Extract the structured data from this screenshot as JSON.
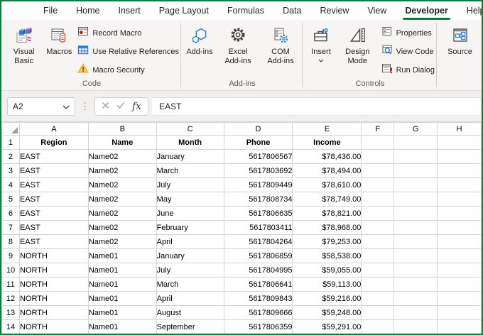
{
  "colors": {
    "accent_green": "#107C41",
    "table_header_fill": "#B4C6E7",
    "icon_blue": "#2E7DD1",
    "icon_red": "#C50F1F",
    "icon_amber": "#FFC83D"
  },
  "tab_bar": {
    "tabs": [
      {
        "label": "File",
        "active": false
      },
      {
        "label": "Home",
        "active": false
      },
      {
        "label": "Insert",
        "active": false
      },
      {
        "label": "Page Layout",
        "active": false
      },
      {
        "label": "Formulas",
        "active": false
      },
      {
        "label": "Data",
        "active": false
      },
      {
        "label": "Review",
        "active": false
      },
      {
        "label": "View",
        "active": false
      },
      {
        "label": "Developer",
        "active": true
      },
      {
        "label": "Help",
        "active": false
      }
    ]
  },
  "ribbon": {
    "groups": [
      {
        "label": "Code",
        "big_buttons": [
          {
            "label": "Visual Basic",
            "icon": "visual-basic-icon"
          },
          {
            "label": "Macros",
            "icon": "macros-icon"
          }
        ],
        "small_buttons": [
          {
            "label": "Record Macro",
            "icon": "record-macro-icon"
          },
          {
            "label": "Use Relative References",
            "icon": "relative-references-icon"
          },
          {
            "label": "Macro Security",
            "icon": "macro-security-icon"
          }
        ]
      },
      {
        "label": "Add-ins",
        "big_buttons": [
          {
            "label": "Add-ins",
            "icon": "addins-icon"
          },
          {
            "label": "Excel Add-ins",
            "icon": "excel-addins-icon"
          },
          {
            "label": "COM Add-ins",
            "icon": "com-addins-icon"
          }
        ],
        "small_buttons": []
      },
      {
        "label": "Controls",
        "big_buttons": [
          {
            "label": "Insert",
            "icon": "insert-control-icon",
            "dropdown": true
          },
          {
            "label": "Design Mode",
            "icon": "design-mode-icon"
          }
        ],
        "small_buttons": [
          {
            "label": "Properties",
            "icon": "properties-icon"
          },
          {
            "label": "View Code",
            "icon": "view-code-icon"
          },
          {
            "label": "Run Dialog",
            "icon": "run-dialog-icon"
          }
        ]
      },
      {
        "label": "",
        "big_buttons": [
          {
            "label": "Source",
            "icon": "source-icon"
          }
        ],
        "small_buttons": []
      }
    ]
  },
  "formula_bar": {
    "name_box": "A2",
    "fx_label": "fx",
    "formula": "EAST"
  },
  "grid": {
    "column_headers": [
      "A",
      "B",
      "C",
      "D",
      "E",
      "F",
      "G",
      "H"
    ],
    "table_header_row": {
      "row_num": "1",
      "cells": [
        "Region",
        "Name",
        "Month",
        "Phone",
        "Income"
      ]
    },
    "rows": [
      {
        "n": "2",
        "region": "EAST",
        "name": "Name02",
        "month": "January",
        "phone": "5617806567",
        "income": "$78,436.00"
      },
      {
        "n": "3",
        "region": "EAST",
        "name": "Name02",
        "month": "March",
        "phone": "5617803692",
        "income": "$78,494.00"
      },
      {
        "n": "4",
        "region": "EAST",
        "name": "Name02",
        "month": "July",
        "phone": "5617809449",
        "income": "$78,610.00"
      },
      {
        "n": "5",
        "region": "EAST",
        "name": "Name02",
        "month": "May",
        "phone": "5617808734",
        "income": "$78,749.00"
      },
      {
        "n": "6",
        "region": "EAST",
        "name": "Name02",
        "month": "June",
        "phone": "5617806635",
        "income": "$78,821.00"
      },
      {
        "n": "7",
        "region": "EAST",
        "name": "Name02",
        "month": "February",
        "phone": "5617803411",
        "income": "$78,968.00"
      },
      {
        "n": "8",
        "region": "EAST",
        "name": "Name02",
        "month": "April",
        "phone": "5617804264",
        "income": "$79,253.00"
      },
      {
        "n": "9",
        "region": "NORTH",
        "name": "Name01",
        "month": "January",
        "phone": "5617806859",
        "income": "$58,538.00"
      },
      {
        "n": "10",
        "region": "NORTH",
        "name": "Name01",
        "month": "July",
        "phone": "5617804995",
        "income": "$59,055.00"
      },
      {
        "n": "11",
        "region": "NORTH",
        "name": "Name01",
        "month": "March",
        "phone": "5617806641",
        "income": "$59,113.00"
      },
      {
        "n": "12",
        "region": "NORTH",
        "name": "Name01",
        "month": "April",
        "phone": "5617809843",
        "income": "$59,216.00"
      },
      {
        "n": "13",
        "region": "NORTH",
        "name": "Name01",
        "month": "August",
        "phone": "5617809666",
        "income": "$59,248.00"
      },
      {
        "n": "14",
        "region": "NORTH",
        "name": "Name01",
        "month": "September",
        "phone": "5617806359",
        "income": "$59,291.00"
      }
    ]
  }
}
